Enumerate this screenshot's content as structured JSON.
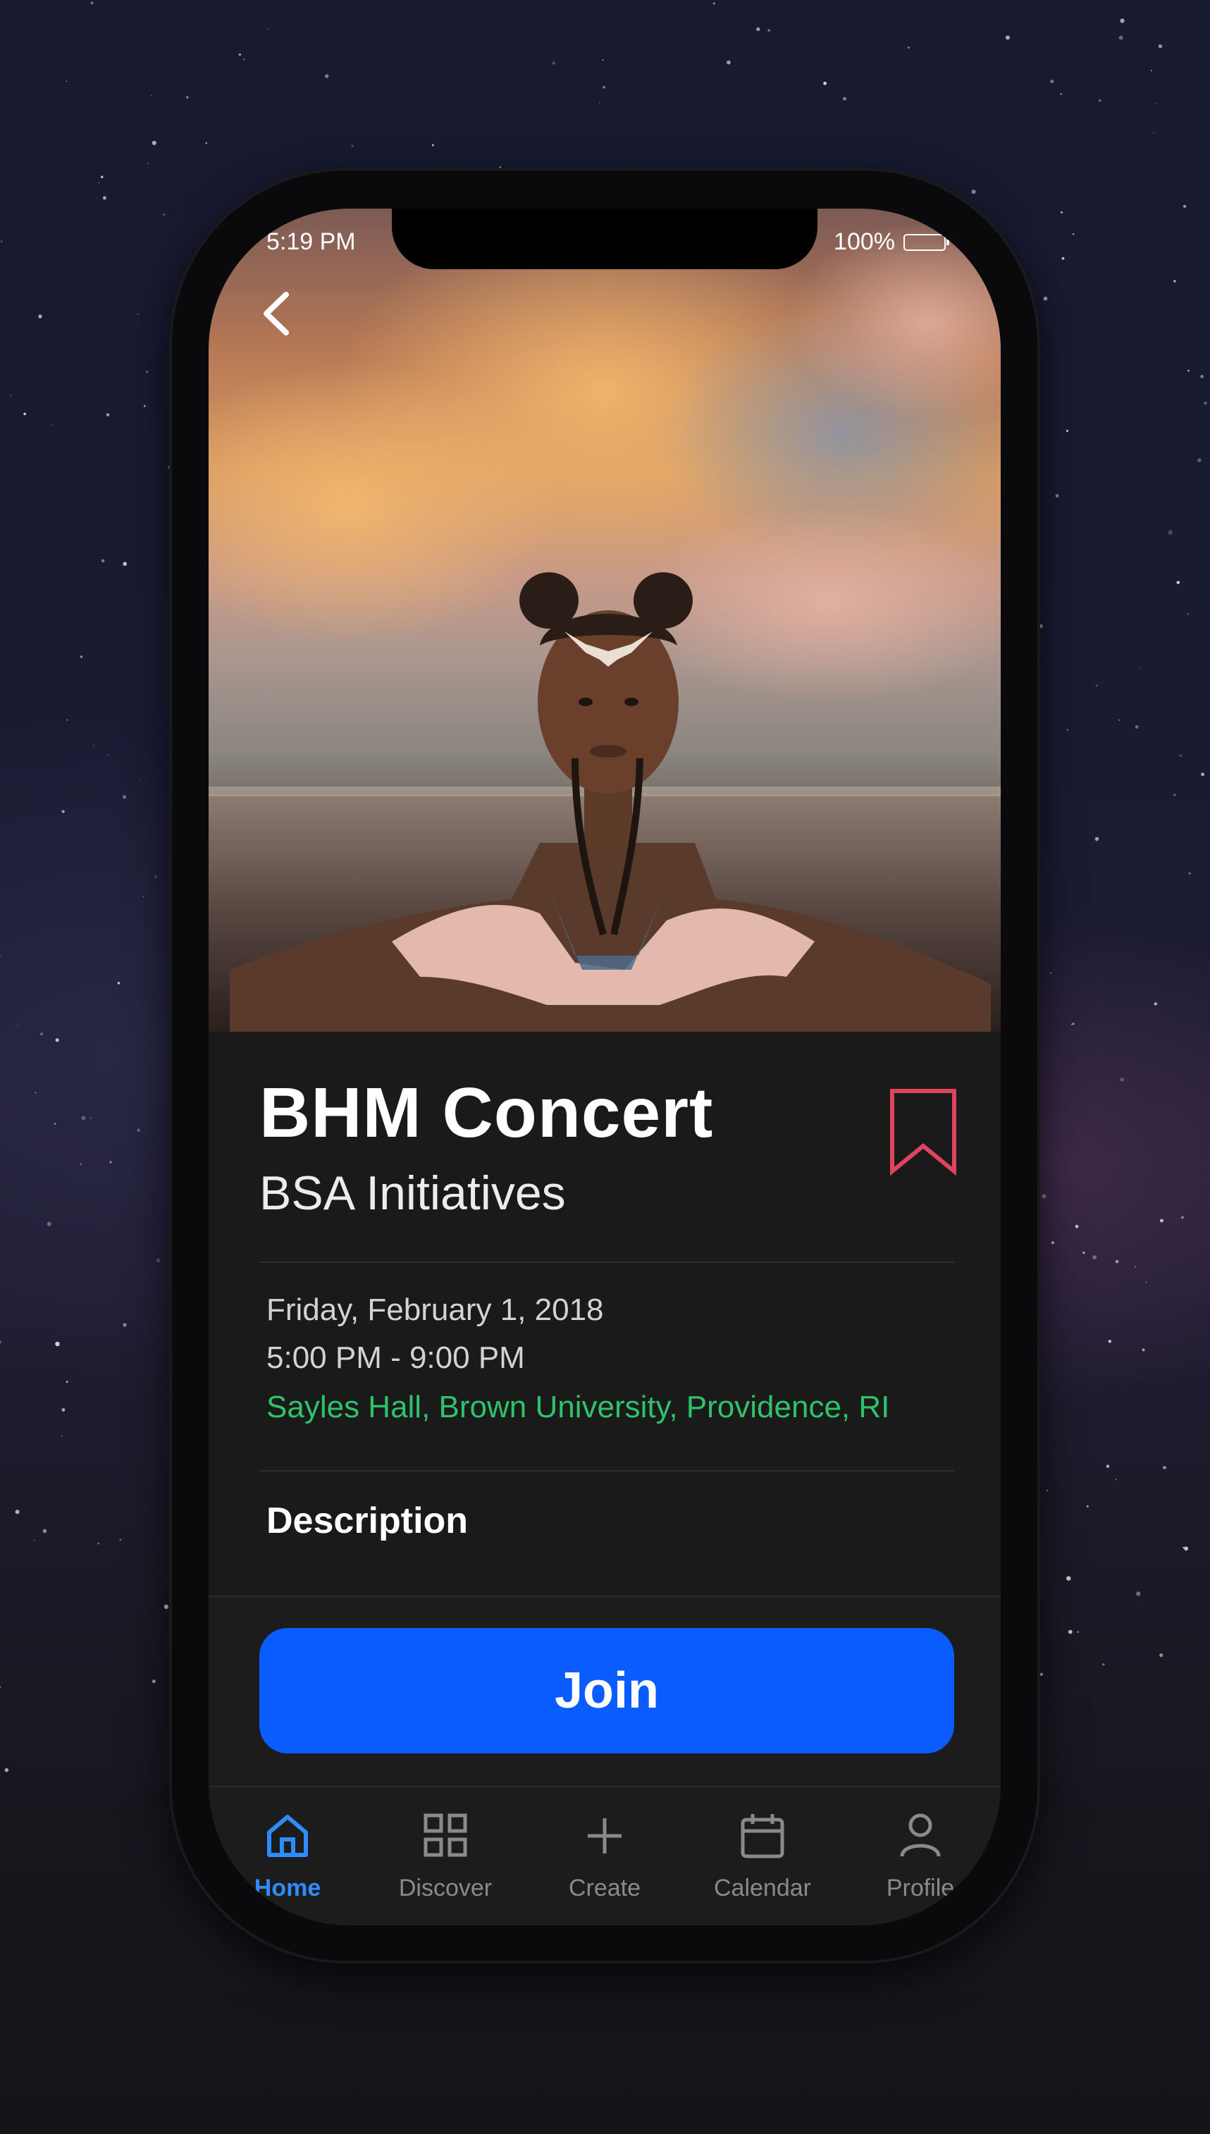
{
  "status_bar": {
    "time": "5:19 PM",
    "battery": "100%",
    "battery_level": 1.0
  },
  "event": {
    "title": "BHM Concert",
    "organizer": "BSA Initiatives",
    "date": "Friday, February 1, 2018",
    "time": "5:00 PM - 9:00 PM",
    "location": "Sayles Hall, Brown University, Providence, RI",
    "description_heading": "Description"
  },
  "actions": {
    "join_label": "Join"
  },
  "tabs": [
    {
      "label": "Home",
      "icon": "home-icon",
      "active": true
    },
    {
      "label": "Discover",
      "icon": "grid-icon",
      "active": false
    },
    {
      "label": "Create",
      "icon": "plus-icon",
      "active": false
    },
    {
      "label": "Calendar",
      "icon": "calendar-icon",
      "active": false
    },
    {
      "label": "Profile",
      "icon": "person-icon",
      "active": false
    }
  ],
  "colors": {
    "accent_blue": "#0b5cff",
    "active_tab": "#2f8cff",
    "location_green": "#2ec36b",
    "bookmark_red": "#e0435e",
    "background": "#1a1a1b"
  }
}
